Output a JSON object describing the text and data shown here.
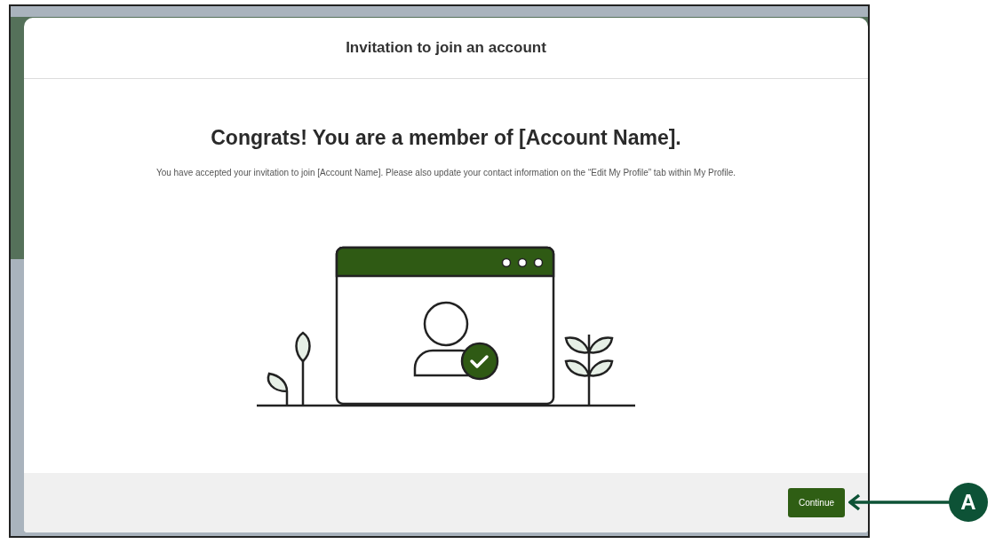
{
  "modal": {
    "title": "Invitation to join an account",
    "heading": "Congrats! You are a member of [Account Name].",
    "message": "You have accepted your invitation to join [Account Name]. Please also update your contact information on the “Edit My Profile” tab within My Profile.",
    "buttons": [
      {
        "label": "Continue"
      }
    ]
  },
  "annotation": {
    "label": "A"
  }
}
